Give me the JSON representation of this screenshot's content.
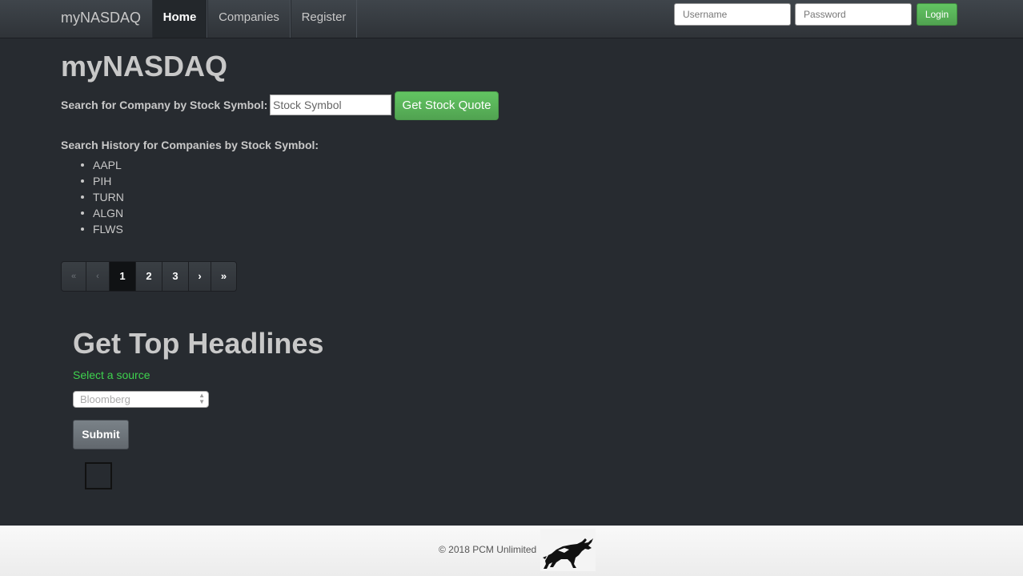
{
  "navbar": {
    "brand": "myNASDAQ",
    "tabs": [
      {
        "label": "Home",
        "active": true
      },
      {
        "label": "Companies",
        "active": false
      },
      {
        "label": "Register",
        "active": false
      }
    ],
    "username_placeholder": "Username",
    "password_placeholder": "Password",
    "login_label": "Login"
  },
  "main": {
    "title": "myNASDAQ",
    "search_label": "Search for Company by Stock Symbol:",
    "symbol_placeholder": "Stock Symbol",
    "quote_button": "Get Stock Quote",
    "history_label": "Search History for Companies by Stock Symbol:",
    "history": [
      "AAPL",
      "PIH",
      "TURN",
      "ALGN",
      "FLWS"
    ],
    "pagination": {
      "first": "«",
      "prev": "‹",
      "pages": [
        "1",
        "2",
        "3"
      ],
      "current": "1",
      "next": "›",
      "last": "»"
    }
  },
  "headlines": {
    "title": "Get Top Headlines",
    "source_label": "Select a source",
    "selected_source": "Bloomberg",
    "submit_label": "Submit"
  },
  "footer": {
    "copyright": "© 2018 PCM Unlimited",
    "logo_icon": "bull-logo-icon"
  },
  "colors": {
    "background": "#272b30",
    "success": "#62c462",
    "source_label": "#3ed24e",
    "footer_bg": "#f5f5f5"
  }
}
